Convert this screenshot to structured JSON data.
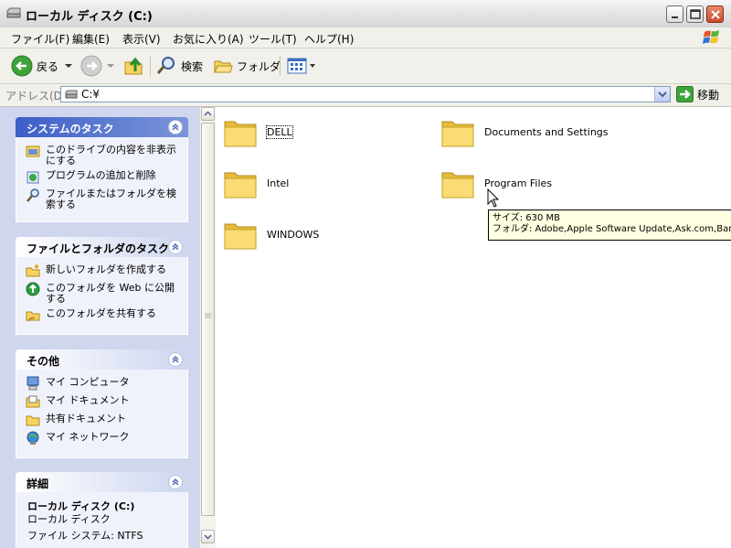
{
  "window": {
    "title": "ローカル ディスク (C:)",
    "icons": [
      "drive-icon",
      "minimize-icon",
      "maximize-icon",
      "close-icon"
    ]
  },
  "menu": {
    "items": [
      "ファイル(F)",
      "編集(E)",
      "表示(V)",
      "お気に入り(A)",
      "ツール(T)",
      "ヘルプ(H)"
    ]
  },
  "toolbar": {
    "back_label": "戻る",
    "search_label": "検索",
    "folders_label": "フォルダ"
  },
  "address": {
    "label": "アドレス(D)",
    "value": "C:¥",
    "go_label": "移動"
  },
  "left_pane": {
    "panels": [
      {
        "title": "システムのタスク",
        "tasks": [
          "このドライブの内容を非表示にする",
          "プログラムの追加と削除",
          "ファイルまたはフォルダを検索する"
        ]
      },
      {
        "title": "ファイルとフォルダのタスク",
        "tasks": [
          "新しいフォルダを作成する",
          "このフォルダを Web に公開する",
          "このフォルダを共有する"
        ]
      },
      {
        "title": "その他",
        "tasks": [
          "マイ コンピュータ",
          "マイ ドキュメント",
          "共有ドキュメント",
          "マイ ネットワーク"
        ]
      },
      {
        "title": "詳細",
        "details": {
          "name": "ローカル ディスク (C:)",
          "type": "ローカル ディスク",
          "filesystem": "ファイル システム: NTFS"
        }
      }
    ]
  },
  "folders": [
    "DELL",
    "Documents and Settings",
    "Intel",
    "Program Files",
    "WINDOWS"
  ],
  "tooltip": {
    "size": "サイズ: 630 MB",
    "folders": "フォルダ: Adobe,Apple Software Update,Ask.com,Ban"
  },
  "colors": {
    "panel_title": "#215dc6",
    "tooltip_bg": "#ffffe1",
    "folder_yellow": "#f6d45f"
  }
}
